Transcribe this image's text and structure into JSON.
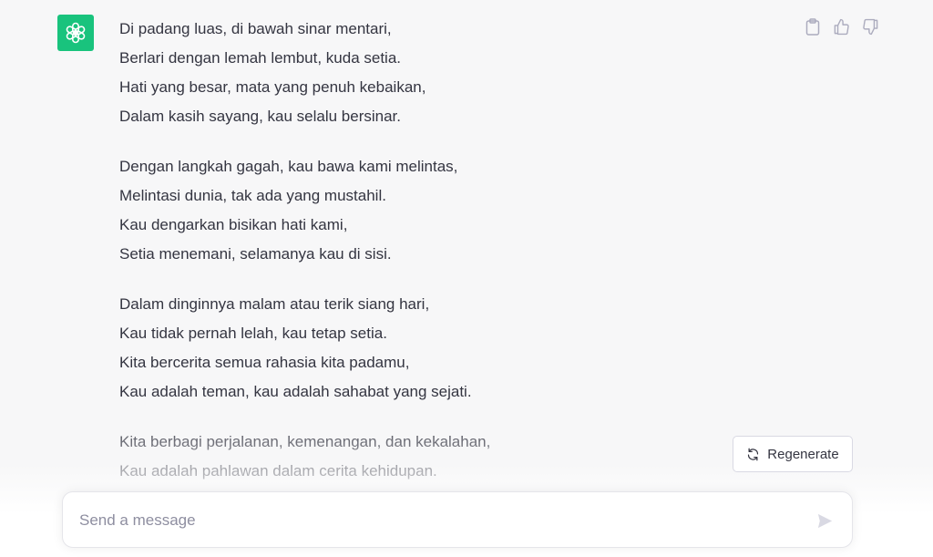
{
  "assistant": {
    "avatar_icon": "openai-logo-icon",
    "avatar_color": "#19c37d"
  },
  "message": {
    "stanzas": [
      [
        "Di padang luas, di bawah sinar mentari,",
        "Berlari dengan lemah lembut, kuda setia.",
        "Hati yang besar, mata yang penuh kebaikan,",
        "Dalam kasih sayang, kau selalu bersinar."
      ],
      [
        "Dengan langkah gagah, kau bawa kami melintas,",
        "Melintasi dunia, tak ada yang mustahil.",
        "Kau dengarkan bisikan hati kami,",
        "Setia menemani, selamanya kau di sisi."
      ],
      [
        "Dalam dinginnya malam atau terik siang hari,",
        "Kau tidak pernah lelah, kau tetap setia.",
        "Kita bercerita semua rahasia kita padamu,",
        "Kau adalah teman, kau adalah sahabat yang sejati."
      ],
      [
        "Kita berbagi perjalanan, kemenangan, dan kekalahan,",
        "Kau adalah pahlawan dalam cerita kehidupan."
      ]
    ]
  },
  "actions": {
    "copy_icon": "clipboard-icon",
    "like_icon": "thumbs-up-icon",
    "dislike_icon": "thumbs-down-icon"
  },
  "regenerate": {
    "label": "Regenerate",
    "icon": "refresh-icon"
  },
  "composer": {
    "placeholder": "Send a message",
    "value": "",
    "send_icon": "send-icon"
  }
}
